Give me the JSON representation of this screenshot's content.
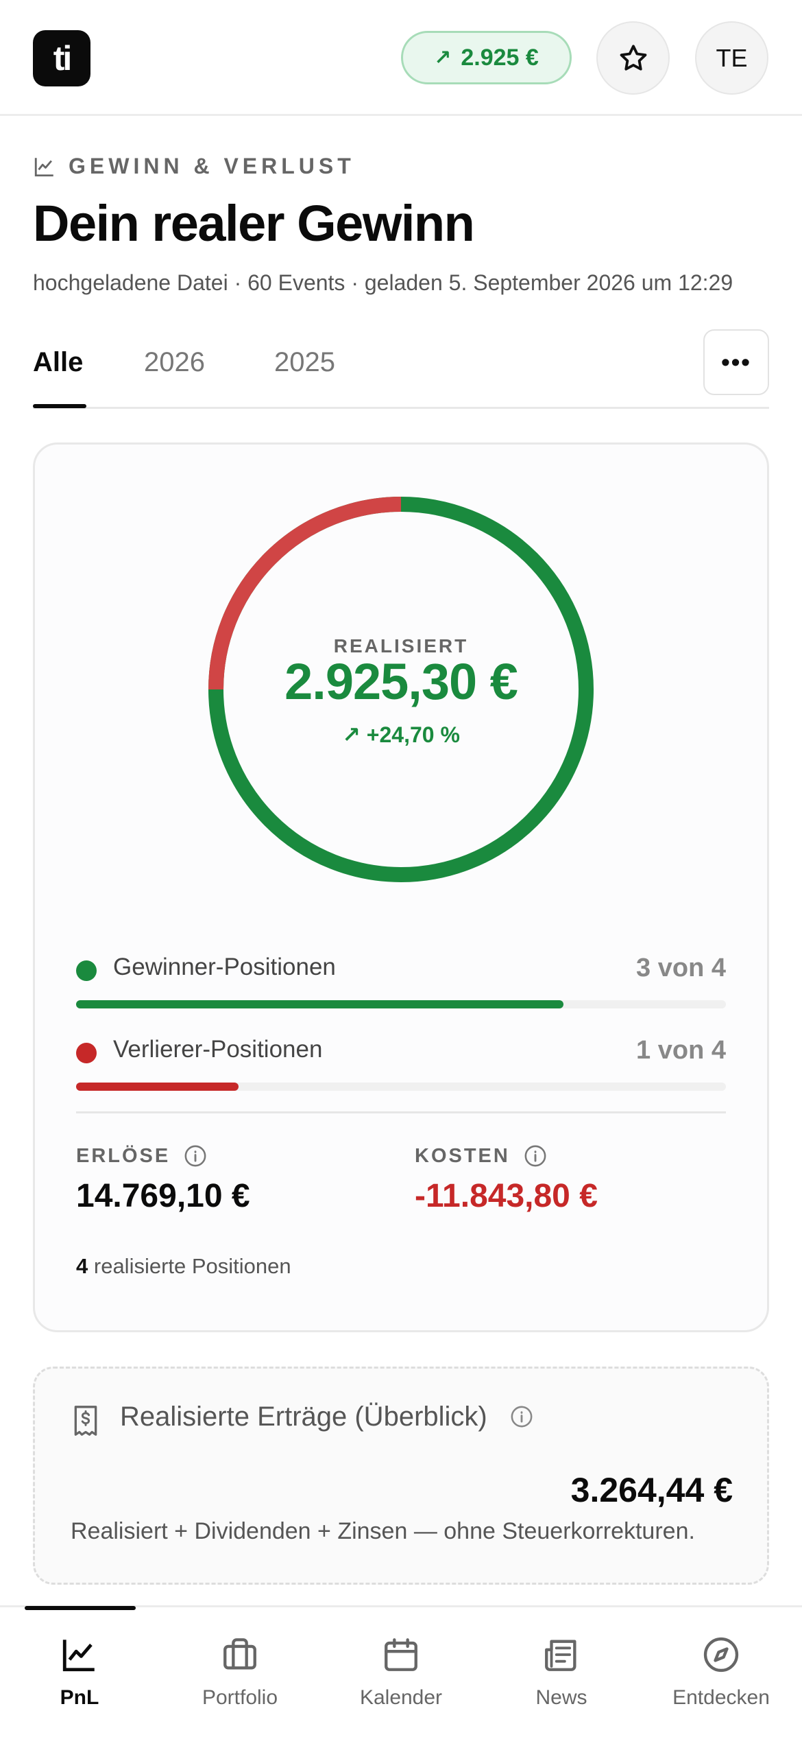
{
  "header": {
    "logo_text": "ti",
    "gain_pill": "2.925 €",
    "avatar_initials": "TE"
  },
  "section": {
    "eyebrow": "GEWINN & VERLUST",
    "title": "Dein realer Gewinn",
    "meta": "hochgeladene Datei · 60 Events · geladen 5. September 2026 um 12:29"
  },
  "tabs": [
    {
      "label": "Alle",
      "active": true
    },
    {
      "label": "2026",
      "active": false
    },
    {
      "label": "2025",
      "active": false
    }
  ],
  "more_label": "•••",
  "summary_card": {
    "realized_label": "REALISIERT",
    "realized_amount": "2.925,30 €",
    "realized_pct": "+24,70 %",
    "winners": {
      "label": "Gewinner-Positionen",
      "count": "3 von 4",
      "fraction": 0.75
    },
    "losers": {
      "label": "Verlierer-Positionen",
      "count": "1 von 4",
      "fraction": 0.25
    },
    "revenue": {
      "label": "ERLÖSE",
      "value": "14.769,10 €"
    },
    "costs": {
      "label": "KOSTEN",
      "value": "-11.843,80 €"
    },
    "positions_count": "4",
    "positions_label": "realisierte Positionen"
  },
  "overview_card": {
    "title": "Realisierte Erträge (Überblick)",
    "amount": "3.264,44 €",
    "note": "Realisiert + Dividenden + Zinsen — ohne Steuerkorrekturen."
  },
  "nav": [
    {
      "label": "PnL",
      "icon": "chart-line-icon",
      "active": true
    },
    {
      "label": "Portfolio",
      "icon": "briefcase-icon",
      "active": false
    },
    {
      "label": "Kalender",
      "icon": "calendar-icon",
      "active": false
    },
    {
      "label": "News",
      "icon": "newspaper-icon",
      "active": false
    },
    {
      "label": "Entdecken",
      "icon": "compass-icon",
      "active": false
    }
  ],
  "colors": {
    "gain": "#1a8a3e",
    "loss": "#c62828",
    "donut_loss": "#d04545"
  }
}
